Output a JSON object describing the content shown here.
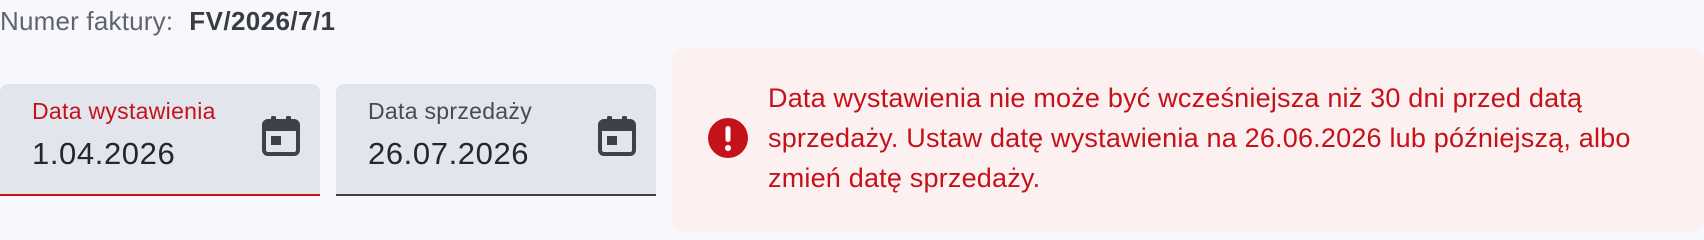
{
  "invoice": {
    "number_label": "Numer faktury:",
    "number_value": "FV/2026/7/1"
  },
  "fields": {
    "issue_date": {
      "label": "Data wystawienia",
      "value": "1.04.2026",
      "icon": "calendar-icon",
      "state": "error"
    },
    "sale_date": {
      "label": "Data sprzedaży",
      "value": "26.07.2026",
      "icon": "calendar-icon"
    }
  },
  "error": {
    "icon": "exclamation-circle-icon",
    "message": "Data wystawienia nie może być wcześniejsza niż 30 dni przed datą sprzedaży. Ustaw datę wystawienia na 26.06.2026 lub późniejszą, albo zmień datę sprzedaży."
  },
  "colors": {
    "error": "#c4121b",
    "error_bg": "#fdf0f0",
    "field_bg": "#e3e5ec",
    "page_bg": "#f8f8fc"
  }
}
